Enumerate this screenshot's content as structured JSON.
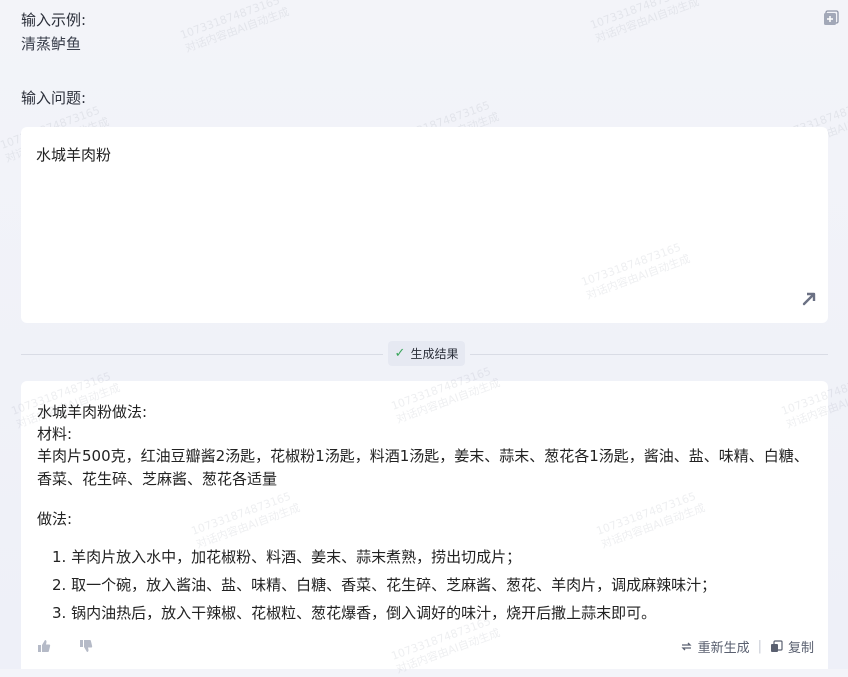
{
  "example": {
    "label": "输入示例:",
    "value": "清蒸鲈鱼"
  },
  "question": {
    "label": "输入问题:",
    "text": "水城羊肉粉"
  },
  "generate": {
    "label": "生成结果"
  },
  "result": {
    "title": "水城羊肉粉做法:",
    "materials_label": "材料:",
    "materials_line1": "羊肉片500克，红油豆瓣酱2汤匙，花椒粉1汤匙，料酒1汤匙，姜末、蒜末、葱花各1汤匙，酱油、盐、味精、白糖、",
    "materials_line2": "香菜、花生碎、芝麻酱、葱花各适量",
    "method_label": "做法:",
    "steps": [
      "1. 羊肉片放入水中，加花椒粉、料酒、姜末、蒜末煮熟，捞出切成片；",
      "2. 取一个碗，放入酱油、盐、味精、白糖、香菜、花生碎、芝麻酱、葱花、羊肉片，调成麻辣味汁；",
      "3. 锅内油热后，放入干辣椒、花椒粒、葱花爆香，倒入调好的味汁，烧开后撒上蒜末即可。"
    ]
  },
  "actions": {
    "regenerate": "重新生成",
    "copy": "复制"
  },
  "watermark": {
    "line1": "107331874873165",
    "line2": "对话内容由AI自动生成"
  },
  "icons": [
    "add-square-icon",
    "expand-arrow-icon",
    "check-icon",
    "thumbs-up-icon",
    "thumbs-down-icon",
    "refresh-icon",
    "copy-icon"
  ]
}
